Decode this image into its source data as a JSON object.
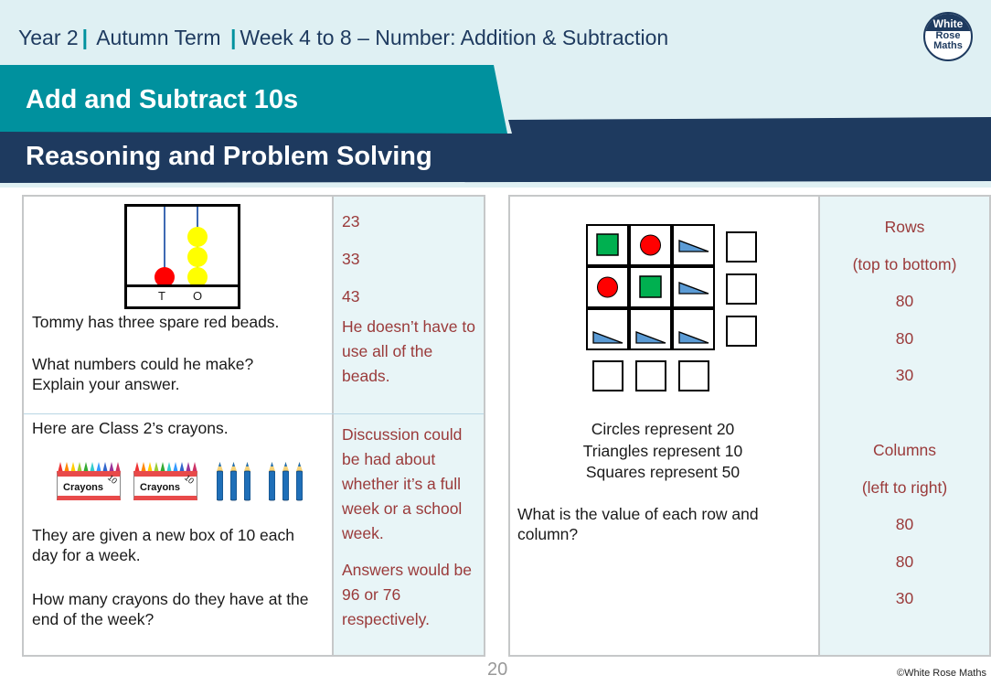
{
  "header": {
    "breadcrumb": [
      "Year 2",
      "Autumn Term",
      "Week 4 to 8 – Number: Addition & Subtraction"
    ],
    "separator": "|",
    "title": "Add and Subtract 10s",
    "subtitle": "Reasoning and Problem Solving",
    "logo": {
      "line1": "White",
      "line2": "Rose",
      "line3": "Maths"
    },
    "colors": {
      "teal": "#00919e",
      "navy": "#1e3a5f",
      "light": "#dff0f3"
    }
  },
  "left_panel": {
    "q1": {
      "abacus": {
        "labels": [
          "T",
          "O"
        ],
        "tens_beads": 1,
        "ones_beads": 3,
        "tens_color": "#ff0000",
        "ones_color": "#ffff00"
      },
      "text": [
        "Tommy has three spare red beads.",
        "What numbers could he make?",
        "Explain your answer."
      ],
      "answers": [
        "23",
        "33",
        "43"
      ],
      "note": [
        "He doesn’t have to",
        "use all of the",
        "beads."
      ]
    },
    "q2": {
      "intro": "Here are Class 2’s crayons.",
      "crayon_boxes": [
        {
          "label": "Crayons",
          "count": "10"
        },
        {
          "label": "Crayons",
          "count": "10"
        }
      ],
      "loose_crayons": 6,
      "text1": [
        "They are given a new box of 10 each",
        "day for a week."
      ],
      "text2": [
        "How many crayons do they have at the",
        "end of the week?"
      ],
      "answer1": [
        "Discussion could",
        "be had about",
        "whether it’s a full",
        "week or a school",
        "week."
      ],
      "answer2": [
        "Answers would be",
        "96 or 76",
        "respectively."
      ]
    }
  },
  "right_panel": {
    "grid": [
      [
        "square",
        "circle",
        "triangle"
      ],
      [
        "circle",
        "square",
        "triangle"
      ],
      [
        "triangle",
        "triangle",
        "triangle"
      ]
    ],
    "key": [
      "Circles represent 20",
      "Triangles represent 10",
      "Squares represent 50"
    ],
    "question": [
      "What is the value of each row and",
      "column?"
    ],
    "answers": {
      "rows_label": "Rows",
      "rows_order": "(top to bottom)",
      "rows": [
        "80",
        "80",
        "30"
      ],
      "cols_label": "Columns",
      "cols_order": "(left to right)",
      "cols": [
        "80",
        "80",
        "30"
      ]
    }
  },
  "footer": {
    "page_number": "20",
    "copyright": "©White Rose Maths"
  }
}
